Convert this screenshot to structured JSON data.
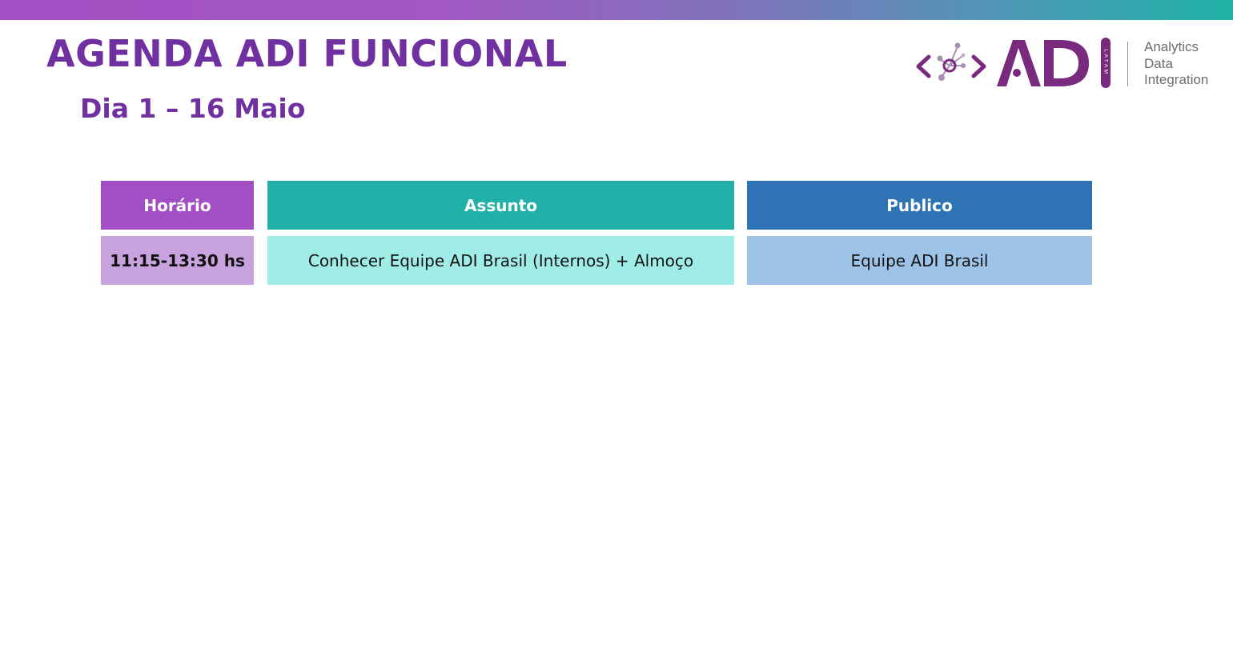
{
  "slide": {
    "title": "AGENDA ADI FUNCIONAL",
    "subtitle": "Dia 1 – 16 Maio"
  },
  "logo": {
    "wordmark": "ADI",
    "latam": "LATAM",
    "tagline": [
      "Analytics",
      "Data",
      "Integration"
    ],
    "primary_color": "#7a2a7e"
  },
  "agenda": {
    "headers": [
      "Horário",
      "Assunto",
      "Publico"
    ],
    "rows": [
      [
        "11:15-13:30 hs",
        "Conhecer Equipe ADI Brasil (Internos) + Almoço",
        "Equipe ADI Brasil"
      ]
    ]
  },
  "colors": {
    "title": "#7030a0",
    "header_horario": "#a24fc3",
    "header_assunto": "#20b0a8",
    "header_publico": "#2e74b5",
    "cell_horario": "#c9a3de",
    "cell_assunto": "#a0ede8",
    "cell_publico": "#9dc3e6"
  }
}
